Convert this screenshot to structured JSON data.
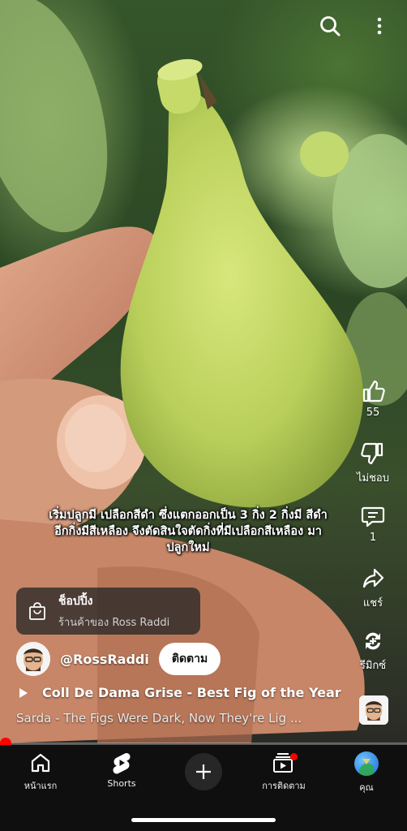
{
  "top_bar": {
    "search_icon": "search-icon",
    "more_icon": "more-vertical-icon"
  },
  "actions": {
    "like": {
      "icon": "thumbs-up-icon",
      "label": "55"
    },
    "dislike": {
      "icon": "thumbs-down-icon",
      "label": "ไม่ชอบ"
    },
    "comments": {
      "icon": "comment-icon",
      "label": "1"
    },
    "share": {
      "icon": "share-icon",
      "label": "แชร์"
    },
    "remix": {
      "icon": "remix-icon",
      "label": "รีมิกซ์"
    }
  },
  "caption": {
    "line1": "เริ่มปลูกมี เปลือกสีดำ  ซึ่งแตกออกเป็น 3 กิ่ง 2 กิ่งมี สีดำ",
    "line2": "อีกกิ่งมีสีเหลือง จึงตัดสินใจตัดกิ่งที่มีเปลือกสีเหลือง มา",
    "line3": "ปลูกใหม่"
  },
  "shopping": {
    "title": "ช็อปปิ้ง",
    "subtitle": "ร้านค้าของ Ross Raddi",
    "icon": "shopping-bag-icon"
  },
  "channel": {
    "name": "@RossRaddi",
    "subscribe_label": "ติดตาม"
  },
  "video": {
    "title": "Coll De Dama Grise - Best Fig of the Year"
  },
  "sound": {
    "text": "Sarda - The Figs Were Dark, Now They're Lig ..."
  },
  "progress": {
    "fraction": 0.01
  },
  "nav": {
    "home": "หน้าแรก",
    "shorts": "Shorts",
    "subscriptions": "การติดตาม",
    "you": "คุณ"
  },
  "colors": {
    "accent": "#ff0000",
    "nav_bg": "#0f0f0f",
    "chip_bg": "#282828"
  }
}
